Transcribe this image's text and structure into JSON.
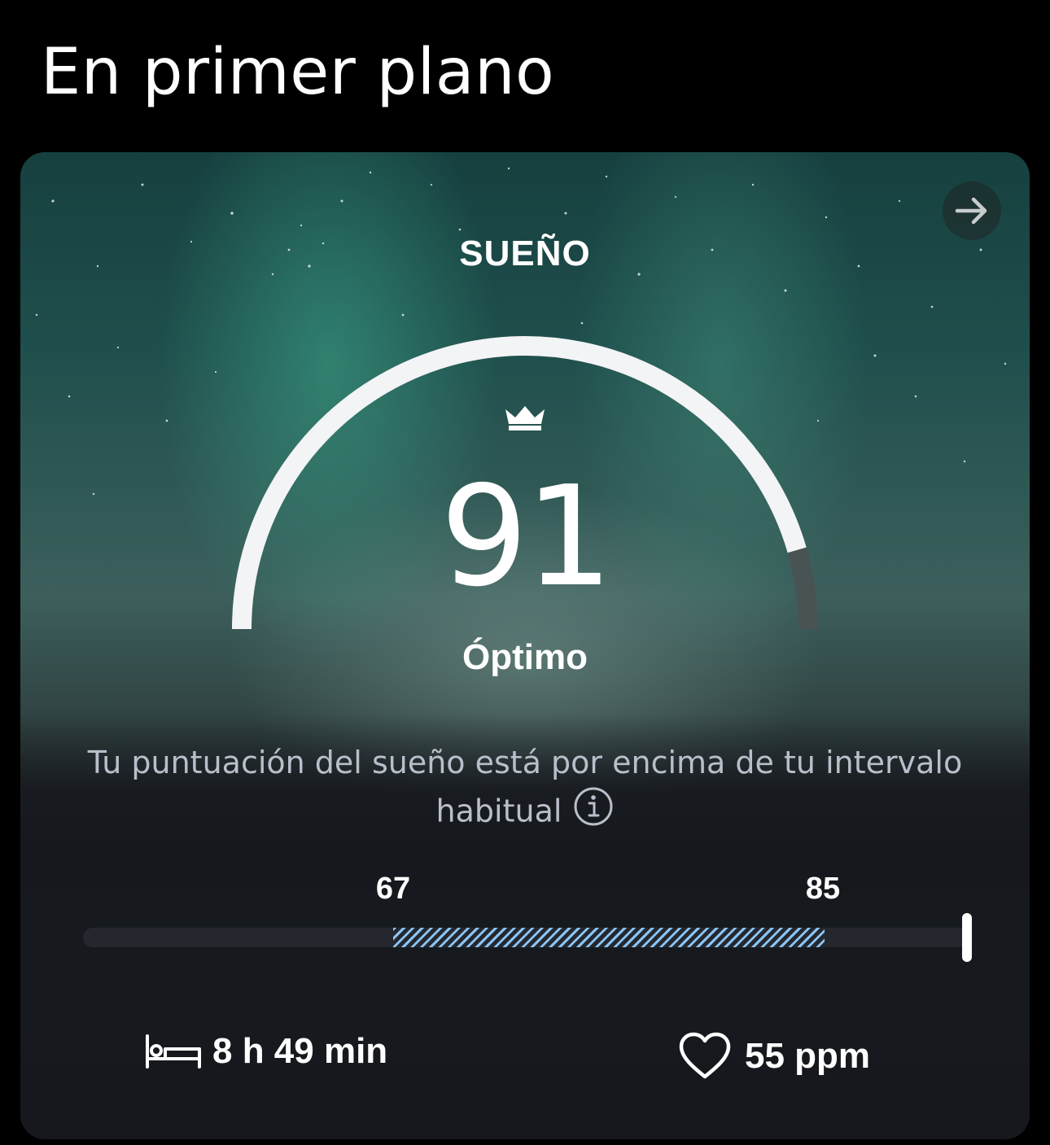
{
  "header": {
    "title": "En primer plano"
  },
  "card": {
    "title": "SUEÑO",
    "score": "91",
    "rating": "Óptimo",
    "score_fraction": 0.91,
    "description": "Tu puntuación del sueño está por encima de tu intervalo habitual",
    "range": {
      "low": "67",
      "high": "85",
      "current": 91
    },
    "stats": {
      "duration": "8 h 49 min",
      "heart_rate": "55 ppm"
    },
    "icons": {
      "arrow": "arrow-right-icon",
      "crown": "crown-icon",
      "info": "info-icon",
      "bed": "bed-icon",
      "heart": "heart-icon"
    },
    "colors": {
      "gauge_fill": "#f3f4f6",
      "gauge_rest": "#4a5353",
      "range_band": "#8ac4f5"
    }
  }
}
